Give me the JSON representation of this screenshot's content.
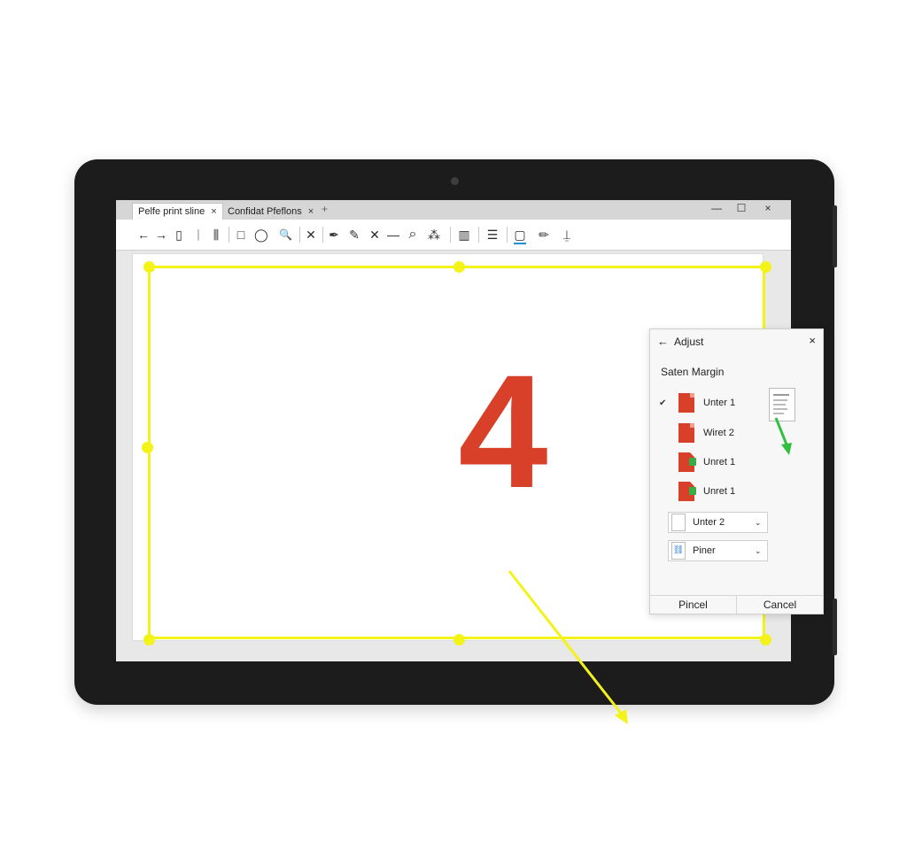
{
  "browser": {
    "tabs": [
      {
        "label": "Pelfe print sline",
        "active": true
      },
      {
        "label": "Confidat Pfeflons",
        "active": false
      }
    ],
    "tab_close_glyph": "×",
    "new_tab_glyph": "+",
    "window_controls": {
      "minimize": "—",
      "maximize": "☐",
      "close": "×"
    }
  },
  "toolbar": {
    "icons": [
      {
        "name": "back-arrow-icon",
        "glyph": "←"
      },
      {
        "name": "forward-arrow-icon",
        "glyph": "→"
      },
      {
        "name": "document-icon",
        "glyph": "▯"
      },
      {
        "name": "text-cursor-icon",
        "glyph": "ᛁ"
      },
      {
        "name": "columns-icon",
        "glyph": "⫼"
      },
      {
        "name": "rectangle-icon",
        "glyph": "□"
      },
      {
        "name": "lasso-icon",
        "glyph": "◯"
      },
      {
        "name": "zoom-icon",
        "glyph": "🔍"
      },
      {
        "name": "delete-x-icon",
        "glyph": "✕"
      },
      {
        "name": "pen-icon",
        "glyph": "✒"
      },
      {
        "name": "marker-icon",
        "glyph": "✎"
      },
      {
        "name": "cross-icon",
        "glyph": "✕"
      },
      {
        "name": "line-icon",
        "glyph": "—"
      },
      {
        "name": "search-icon",
        "glyph": "⌕"
      },
      {
        "name": "effects-icon",
        "glyph": "⁂"
      },
      {
        "name": "book-icon",
        "glyph": "▥"
      },
      {
        "name": "format-icon",
        "glyph": "☰"
      },
      {
        "name": "page-setup-icon",
        "glyph": "▢"
      },
      {
        "name": "pencil-icon",
        "glyph": "✏"
      },
      {
        "name": "stamp-icon",
        "glyph": "⍊"
      }
    ],
    "active_color": "#1a8fd6"
  },
  "document": {
    "digit": "4",
    "digit_color": "#d9402a"
  },
  "margin_guide": {
    "color": "#f3f31a"
  },
  "panel": {
    "back_glyph": "←",
    "title": "Adjust",
    "close_glyph": "×",
    "section_title": "Saten Margin",
    "options": [
      {
        "label": "Unter 1",
        "checked": true,
        "badge": false
      },
      {
        "label": "Wiret 2",
        "checked": false,
        "badge": false
      },
      {
        "label": "Unret 1",
        "checked": false,
        "badge": true
      },
      {
        "label": "Unret 1",
        "checked": false,
        "badge": true
      }
    ],
    "dropdowns": [
      {
        "label": "Unter 2",
        "icon": "blank-page-icon",
        "icon_glyph": ""
      },
      {
        "label": "Piner",
        "icon": "link-pages-icon",
        "icon_glyph": "⛓"
      }
    ],
    "caret_glyph": "⌄",
    "buttons": {
      "primary": "Pincel",
      "cancel": "Cancel"
    }
  }
}
